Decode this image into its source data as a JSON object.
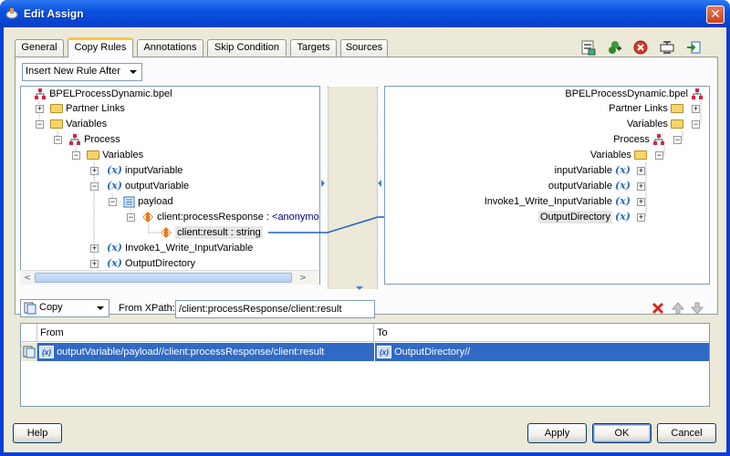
{
  "window": {
    "title": "Edit Assign",
    "close_glyph": "✕"
  },
  "tabs": [
    {
      "label": "General"
    },
    {
      "label": "Copy Rules"
    },
    {
      "label": "Annotations"
    },
    {
      "label": "Skip Condition"
    },
    {
      "label": "Targets"
    },
    {
      "label": "Sources"
    }
  ],
  "insert_dropdown": {
    "value": "Insert New Rule After"
  },
  "toolbar_icons": [
    "xsl-transform-icon",
    "add-rule-icon",
    "delete-rule-icon",
    "expression-builder-icon",
    "copy-icon"
  ],
  "source_tree": [
    {
      "label": "BPELProcessDynamic.bpel",
      "icon": "process-icon"
    },
    {
      "label": "Partner Links",
      "icon": "folder-icon"
    },
    {
      "label": "Variables",
      "icon": "folder-icon"
    },
    {
      "label": "Process",
      "icon": "process-icon"
    },
    {
      "label": "Variables",
      "icon": "folder-icon"
    },
    {
      "label": "inputVariable",
      "icon": "variable-icon"
    },
    {
      "label": "outputVariable",
      "icon": "variable-icon"
    },
    {
      "label": "payload",
      "icon": "message-part-icon"
    },
    {
      "label": "client:processResponse : ",
      "suffix": "<anonymo",
      "icon": "element-icon"
    },
    {
      "label": "client:result : string",
      "icon": "element-icon"
    },
    {
      "label": "Invoke1_Write_InputVariable",
      "icon": "variable-icon"
    },
    {
      "label": "OutputDirectory",
      "icon": "variable-icon"
    }
  ],
  "target_tree": [
    {
      "label": "BPELProcessDynamic.bpel"
    },
    {
      "label": "Partner Links"
    },
    {
      "label": "Variables"
    },
    {
      "label": "Process"
    },
    {
      "label": "Variables"
    },
    {
      "label": "inputVariable"
    },
    {
      "label": "outputVariable"
    },
    {
      "label": "Invoke1_Write_InputVariable"
    },
    {
      "label": "OutputDirectory"
    }
  ],
  "variable_glyph": "(x)",
  "copy_select": {
    "value": "Copy"
  },
  "from_xpath": {
    "label": "From XPath:",
    "value": "/client:processResponse/client:result"
  },
  "rules_table": {
    "headers": [
      "From",
      "To"
    ],
    "rows": [
      {
        "from": "outputVariable/payload//client:processResponse/client:result",
        "to": "OutputDirectory//"
      }
    ]
  },
  "buttons": {
    "help": "Help",
    "apply": "Apply",
    "ok": "OK",
    "cancel": "Cancel"
  },
  "colors": {
    "title_bar": "#0a52e0",
    "selection": "#316ac5",
    "mapping_line": "#2060c0"
  }
}
